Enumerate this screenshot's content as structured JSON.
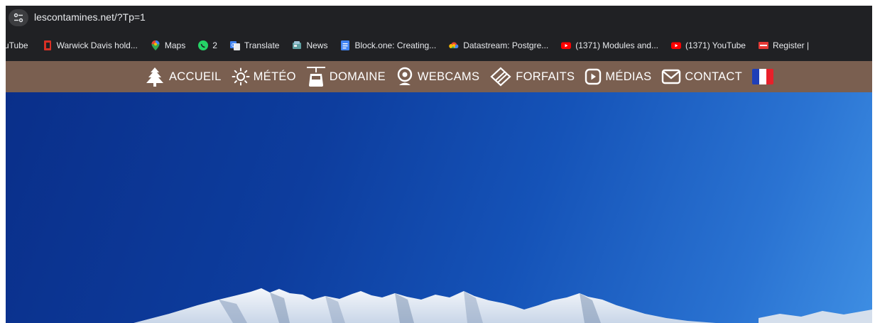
{
  "browser": {
    "url": "lescontamines.net/?Tp=1",
    "bookmarks": [
      {
        "label": "uTube",
        "icon": "youtube-partial",
        "color": "#202124"
      },
      {
        "label": "Warwick Davis hold...",
        "icon": "c-icon",
        "color": "#d93025"
      },
      {
        "label": "Maps",
        "icon": "maps-pin-icon",
        "color": "#34a853"
      },
      {
        "label": "2",
        "icon": "whatsapp-icon",
        "color": "#25d366"
      },
      {
        "label": "Translate",
        "icon": "translate-icon",
        "color": "#4285f4"
      },
      {
        "label": "News",
        "icon": "news-icon",
        "color": "#5f9ea0"
      },
      {
        "label": "Block.one: Creating...",
        "icon": "docs-icon",
        "color": "#4285f4"
      },
      {
        "label": "Datastream: Postgre...",
        "icon": "gcloud-icon",
        "color": "#fbbc04"
      },
      {
        "label": "(1371) Modules and...",
        "icon": "youtube-icon",
        "color": "#ff0000"
      },
      {
        "label": "(1371) YouTube",
        "icon": "youtube-icon",
        "color": "#ff0000"
      },
      {
        "label": "Register |",
        "icon": "register-icon",
        "color": "#e53935"
      }
    ]
  },
  "site_nav": {
    "items": [
      {
        "label": "ACCUEIL",
        "icon": "fir-tree-icon"
      },
      {
        "label": "MÉTÉO",
        "icon": "sun-icon"
      },
      {
        "label": "DOMAINE",
        "icon": "gondola-icon"
      },
      {
        "label": "WEBCAMS",
        "icon": "webcam-icon"
      },
      {
        "label": "FORFAITS",
        "icon": "ski-pass-icon"
      },
      {
        "label": "MÉDIAS",
        "icon": "play-icon"
      },
      {
        "label": "CONTACT",
        "icon": "envelope-icon"
      }
    ],
    "language_flag": "french-flag-icon",
    "background": "#7a5f50"
  },
  "hero": {
    "sky_color": "#0d3d9e",
    "subject": "snow-capped-mountain-range"
  }
}
